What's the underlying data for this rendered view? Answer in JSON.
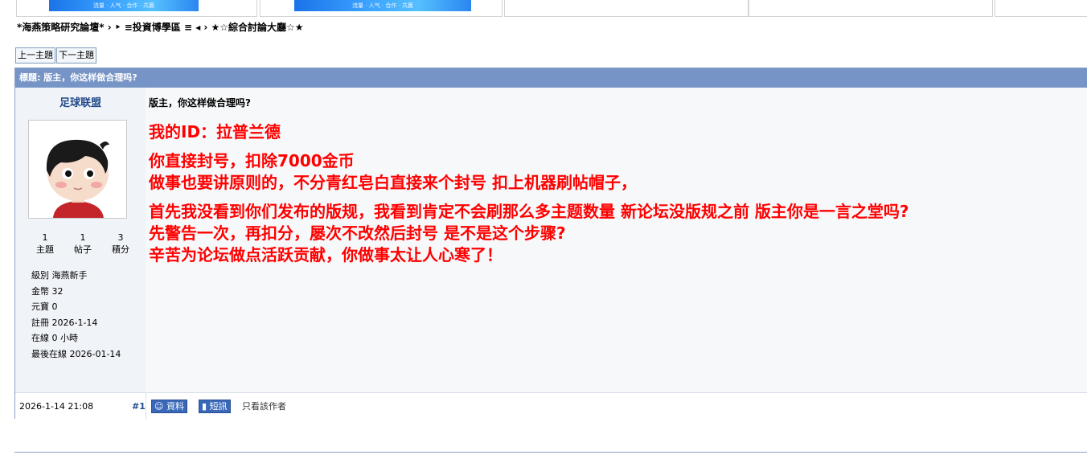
{
  "banner": {
    "ad1_text": "流量 · 人气 · 合作 · 共赢",
    "ad2_text": "流量 · 人气 · 合作 · 共赢"
  },
  "breadcrumb": {
    "forum_name": "*海燕策略研究論壇*",
    "sep1": " › ‣ ",
    "section": "≡投資博學區 ≡",
    "sep2": " ◂ › ",
    "board": "★☆綜合討論大廳☆★"
  },
  "nav": {
    "prev_label": "上一主題",
    "next_label": "下一主題"
  },
  "post": {
    "header_title": "標題: 版主，你这样做合理吗?",
    "title": "版主，你这样做合理吗?",
    "body": [
      [
        "我的ID：拉普兰德"
      ],
      [
        "你直接封号，扣除7000金币",
        "做事也要讲原则的，不分青红皂白直接来个封号 扣上机器刷帖帽子，"
      ],
      [
        "首先我没看到你们发布的版规，我看到肯定不会刷那么多主题数量 新论坛没版规之前 版主你是一言之堂吗?",
        "先警告一次，再扣分，屡次不改然后封号 是不是这个步骤?",
        "辛苦为论坛做点活跃贡献，你做事太让人心寒了！"
      ]
    ],
    "time": "2026-1-14 21:08",
    "floor": "#1",
    "profile_btn": "資料",
    "pm_btn": "短訊",
    "only_author": "只看該作者"
  },
  "user": {
    "name": "足球联盟",
    "stats": {
      "topics_value": "1",
      "topics_label": "主題",
      "posts_value": "1",
      "posts_label": "帖子",
      "points_value": "3",
      "points_label": "積分"
    },
    "info": {
      "level": "級別 海燕新手",
      "gold": "金幣 32",
      "yuanbao": "元寶 0",
      "register": "註冊 2026-1-14",
      "online": "在線 0 小時",
      "last_online": "最後在線 2026-01-14"
    }
  },
  "colors": {
    "header_bg": "#7695c6",
    "body_text": "#ff0000",
    "username": "#224a8a"
  }
}
